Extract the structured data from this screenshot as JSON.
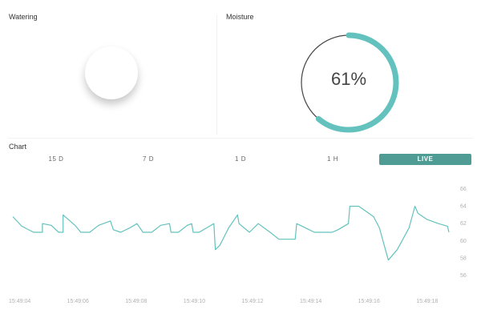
{
  "watering": {
    "title": "Watering"
  },
  "moisture": {
    "title": "Moisture",
    "value_label": "61%",
    "value": 61,
    "accent": "#63c2bd",
    "track": "#444444"
  },
  "chart_section": {
    "title": "Chart",
    "tabs": [
      {
        "label": "15 D",
        "active": false
      },
      {
        "label": "7 D",
        "active": false
      },
      {
        "label": "1 D",
        "active": false
      },
      {
        "label": "1 H",
        "active": false
      },
      {
        "label": "LIVE",
        "active": true
      }
    ],
    "active_color": "#4e9c93"
  },
  "chart_data": {
    "type": "line",
    "line_color": "#63c2bd",
    "x_labels": [
      "15:49:04",
      "15:49:06",
      "15:49:08",
      "15:49:10",
      "15:49:12",
      "15:49:14",
      "15:49:16",
      "15:49:18"
    ],
    "y_ticks": [
      56,
      58,
      60,
      62,
      64,
      66
    ],
    "ylim": [
      55,
      67
    ],
    "series": [
      {
        "points": [
          [
            0.0,
            62.8
          ],
          [
            0.3,
            61.7
          ],
          [
            0.7,
            61.0
          ],
          [
            1.0,
            61.0
          ],
          [
            1.0,
            62.0
          ],
          [
            1.3,
            61.8
          ],
          [
            1.55,
            61.0
          ],
          [
            1.7,
            61.0
          ],
          [
            1.7,
            63.0
          ],
          [
            2.1,
            61.8
          ],
          [
            2.3,
            61.0
          ],
          [
            2.6,
            61.0
          ],
          [
            2.9,
            61.8
          ],
          [
            3.3,
            62.3
          ],
          [
            3.4,
            61.3
          ],
          [
            3.65,
            61.0
          ],
          [
            3.95,
            61.5
          ],
          [
            4.2,
            62.0
          ],
          [
            4.4,
            61.0
          ],
          [
            4.7,
            61.0
          ],
          [
            5.0,
            61.8
          ],
          [
            5.3,
            62.0
          ],
          [
            5.35,
            61.0
          ],
          [
            5.6,
            61.0
          ],
          [
            5.9,
            61.8
          ],
          [
            6.05,
            62.0
          ],
          [
            6.1,
            61.0
          ],
          [
            6.3,
            61.0
          ],
          [
            6.55,
            61.5
          ],
          [
            6.8,
            62.0
          ],
          [
            6.85,
            59.0
          ],
          [
            7.0,
            59.5
          ],
          [
            7.3,
            61.5
          ],
          [
            7.6,
            63.0
          ],
          [
            7.65,
            62.0
          ],
          [
            8.0,
            61.0
          ],
          [
            8.3,
            62.0
          ],
          [
            8.7,
            61.0
          ],
          [
            9.0,
            60.2
          ],
          [
            9.55,
            60.2
          ],
          [
            9.6,
            62.0
          ],
          [
            9.9,
            61.5
          ],
          [
            10.2,
            61.0
          ],
          [
            10.8,
            61.0
          ],
          [
            11.0,
            61.3
          ],
          [
            11.35,
            62.0
          ],
          [
            11.4,
            64.0
          ],
          [
            11.7,
            64.0
          ],
          [
            12.2,
            62.8
          ],
          [
            12.4,
            61.5
          ],
          [
            12.7,
            57.8
          ],
          [
            13.0,
            59.0
          ],
          [
            13.4,
            61.5
          ],
          [
            13.6,
            64.0
          ],
          [
            13.7,
            63.2
          ],
          [
            14.0,
            62.5
          ],
          [
            14.4,
            62.0
          ],
          [
            14.7,
            61.7
          ],
          [
            14.75,
            61.0
          ]
        ]
      }
    ]
  }
}
